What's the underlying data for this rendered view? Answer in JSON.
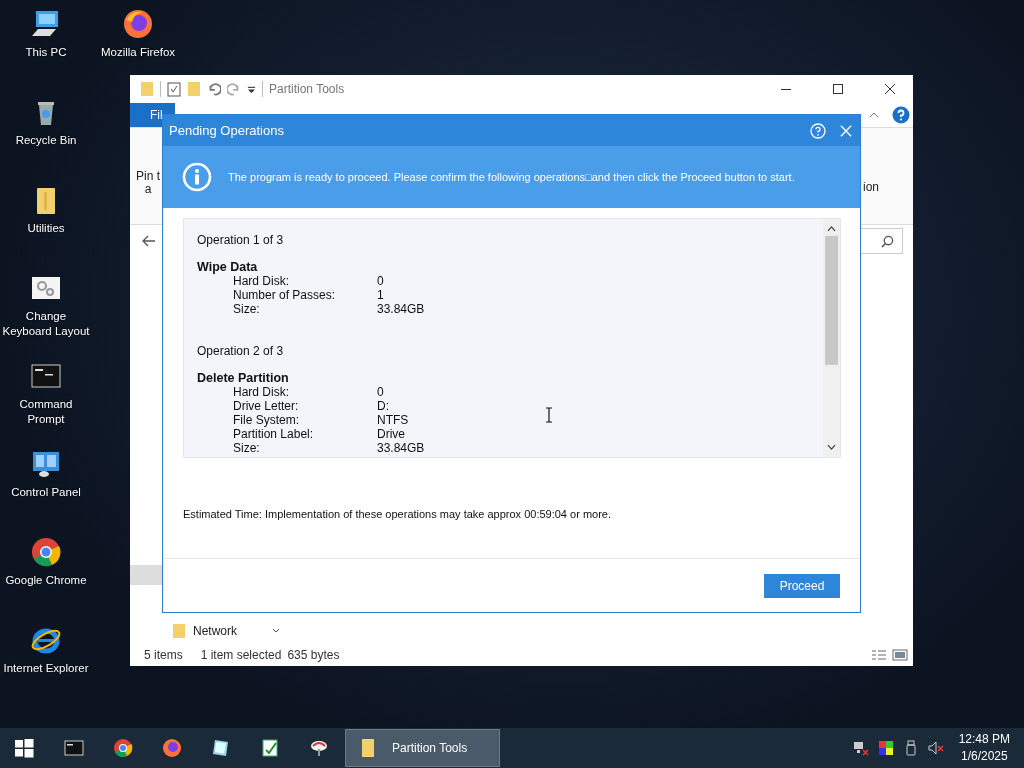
{
  "desktop_icons": [
    {
      "label": "This PC",
      "kind": "pc"
    },
    {
      "label": "Recycle Bin",
      "kind": "bin"
    },
    {
      "label": "Utilities",
      "kind": "folder"
    },
    {
      "label": "Change Keyboard Layout",
      "kind": "settings"
    },
    {
      "label": "Command Prompt",
      "kind": "cmd"
    },
    {
      "label": "Control Panel",
      "kind": "control"
    },
    {
      "label": "Google Chrome",
      "kind": "chrome"
    },
    {
      "label": "Internet Explorer",
      "kind": "ie"
    },
    {
      "label": "Mozilla Firefox",
      "kind": "firefox"
    }
  ],
  "explorer": {
    "title": "Partition Tools",
    "ribbon_tab": "Fil",
    "ribbon_left": [
      "Pin t",
      "a"
    ],
    "ribbon_right": "ion",
    "nav_item": "Network",
    "status_bar": {
      "items": "5 items",
      "selection": "1 item selected",
      "size": "635 bytes"
    }
  },
  "dialog": {
    "title": "Pending Operations",
    "message": "The program is ready to proceed. Please confirm the following operations□and then click the Proceed button to start.",
    "operations": [
      {
        "heading": "Operation 1 of 3",
        "name": "Wipe Data",
        "fields": [
          {
            "label": "Hard Disk:",
            "value": "0"
          },
          {
            "label": "Number of Passes:",
            "value": "1"
          },
          {
            "label": "Size:",
            "value": "33.84GB"
          }
        ]
      },
      {
        "heading": "Operation 2 of 3",
        "name": "Delete Partition",
        "fields": [
          {
            "label": "Hard Disk:",
            "value": "0"
          },
          {
            "label": "Drive Letter:",
            "value": "D:"
          },
          {
            "label": "File System:",
            "value": "NTFS"
          },
          {
            "label": "Partition Label:",
            "value": "Drive"
          },
          {
            "label": "Size:",
            "value": "33.84GB"
          }
        ]
      }
    ],
    "estimate": "Estimated Time: Implementation of these operations may take approx 00:59:04 or more.",
    "button": "Proceed"
  },
  "taskbar": {
    "items": [
      {
        "kind": "cmd",
        "selected": false
      },
      {
        "kind": "chrome",
        "selected": false
      },
      {
        "kind": "firefox",
        "selected": false
      },
      {
        "kind": "notepad",
        "selected": false
      },
      {
        "kind": "document",
        "selected": false
      },
      {
        "kind": "tool",
        "selected": false
      },
      {
        "kind": "folder",
        "label": "Partition Tools",
        "selected": true
      }
    ],
    "tray": [
      {
        "kind": "network"
      },
      {
        "kind": "color"
      },
      {
        "kind": "usb"
      },
      {
        "kind": "muted"
      }
    ],
    "time": "12:48 PM",
    "date": "1/6/2025"
  }
}
